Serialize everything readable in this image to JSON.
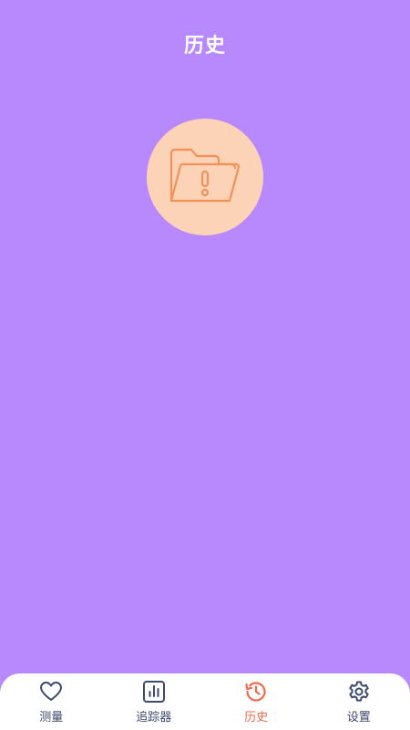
{
  "header": {
    "title": "历史"
  },
  "empty_state": {
    "icon": "folder-alert-icon"
  },
  "nav": {
    "items": [
      {
        "label": "测量",
        "icon": "heart-icon",
        "active": false
      },
      {
        "label": "追踪器",
        "icon": "bar-chart-icon",
        "active": false
      },
      {
        "label": "历史",
        "icon": "history-icon",
        "active": true
      },
      {
        "label": "设置",
        "icon": "gear-icon",
        "active": false
      }
    ]
  },
  "colors": {
    "background": "#b888fd",
    "circle": "#fdd3b7",
    "folder_stroke": "#f2915a",
    "nav_text": "#3c4a6e",
    "active": "#f06a4d"
  }
}
